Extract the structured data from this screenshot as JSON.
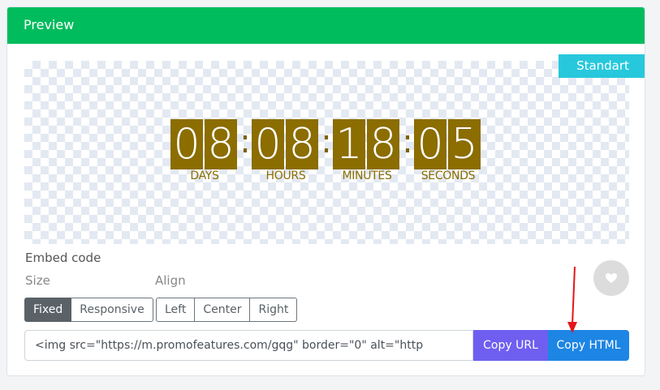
{
  "card": {
    "title": "Preview"
  },
  "preview": {
    "style_badge": "Standart",
    "countdown": [
      {
        "label": "DAYS",
        "digits": [
          "0",
          "8"
        ]
      },
      {
        "label": "HOURS",
        "digits": [
          "0",
          "8"
        ]
      },
      {
        "label": "MINUTES",
        "digits": [
          "1",
          "8"
        ]
      },
      {
        "label": "SECONDS",
        "digits": [
          "0",
          "5"
        ]
      }
    ],
    "separator": ":",
    "colors": {
      "digit_bg": "#8b6d00",
      "digit_text": "#ffffff",
      "label": "#8b6d00"
    }
  },
  "embed": {
    "title": "Embed code",
    "size_label": "Size",
    "align_label": "Align",
    "size_options": [
      "Fixed",
      "Responsive"
    ],
    "size_selected": "Fixed",
    "align_options": [
      "Left",
      "Center",
      "Right"
    ],
    "code_value": "<img src=\"https://m.promofeatures.com/gqg\" border=\"0\" alt=\"http",
    "copy_url_label": "Copy URL",
    "copy_html_label": "Copy HTML"
  },
  "icons": {
    "favorite": "heart-icon",
    "annotation": "red-arrow-down-icon"
  },
  "colors": {
    "header": "#00bc5d",
    "badge": "#27c8dc",
    "copy_url": "#6e5ff0",
    "copy_html": "#1d85e4",
    "annotation": "#e3151a"
  }
}
